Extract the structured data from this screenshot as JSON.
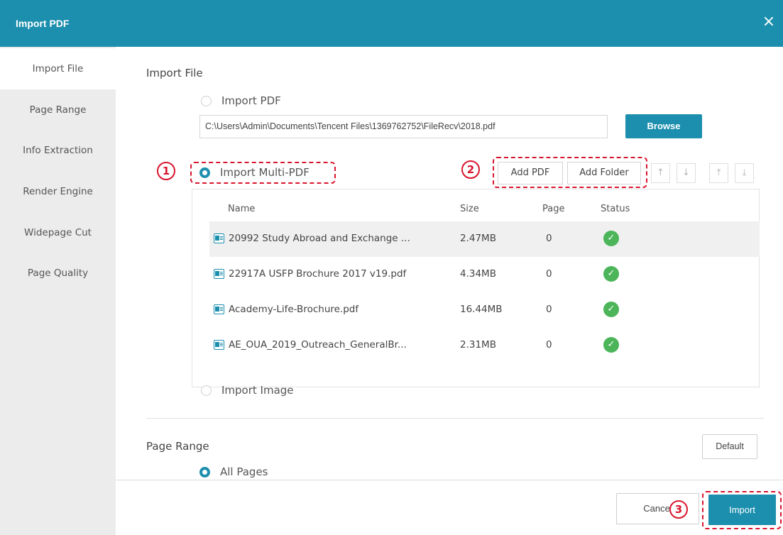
{
  "window": {
    "title": "Import PDF",
    "close_icon": "×"
  },
  "sidebar": {
    "items": [
      {
        "label": "Import File",
        "active": true
      },
      {
        "label": "Page Range"
      },
      {
        "label": "Info Extraction"
      },
      {
        "label": "Render Engine"
      },
      {
        "label": "Widepage Cut"
      },
      {
        "label": "Page Quality"
      }
    ]
  },
  "import_file": {
    "title": "Import File",
    "option_pdf": "Import PDF",
    "path_value": "C:\\Users\\Admin\\Documents\\Tencent Files\\1369762752\\FileRecv\\2018.pdf",
    "browse_label": "Browse",
    "option_multi": "Import Multi-PDF",
    "option_image": "Import Image",
    "selected_option": "Import Multi-PDF"
  },
  "toolbar": {
    "add_pdf": "Add PDF",
    "add_folder": "Add Folder",
    "move_up": "↑",
    "move_down": "↓",
    "move_top": "⤒",
    "move_bottom": "⤓"
  },
  "file_table": {
    "columns": {
      "name": "Name",
      "size": "Size",
      "page": "Page",
      "status": "Status"
    },
    "rows": [
      {
        "name": "20992 Study Abroad and Exchange ...",
        "size": "2.47MB",
        "page": "0",
        "status": "ok",
        "status_glyph": "✓",
        "selected": true
      },
      {
        "name": "22917A USFP Brochure 2017 v19.pdf",
        "size": "4.34MB",
        "page": "0",
        "status": "ok",
        "status_glyph": "✓"
      },
      {
        "name": "Academy-Life-Brochure.pdf",
        "size": "16.44MB",
        "page": "0",
        "status": "ok",
        "status_glyph": "✓"
      },
      {
        "name": "AE_OUA_2019_Outreach_GeneralBr...",
        "size": "2.31MB",
        "page": "0",
        "status": "ok",
        "status_glyph": "✓"
      }
    ]
  },
  "page_range": {
    "title": "Page Range",
    "default_label": "Default",
    "all_pages": "All Pages"
  },
  "annotations": {
    "step1": "1",
    "step2": "2",
    "step3": "3"
  },
  "footer": {
    "cancel_label": "Cancel",
    "import_label": "Import"
  },
  "colors": {
    "accent": "#1c8fae",
    "annotation_red": "#d9152d",
    "status_green": "#4cb55a"
  }
}
